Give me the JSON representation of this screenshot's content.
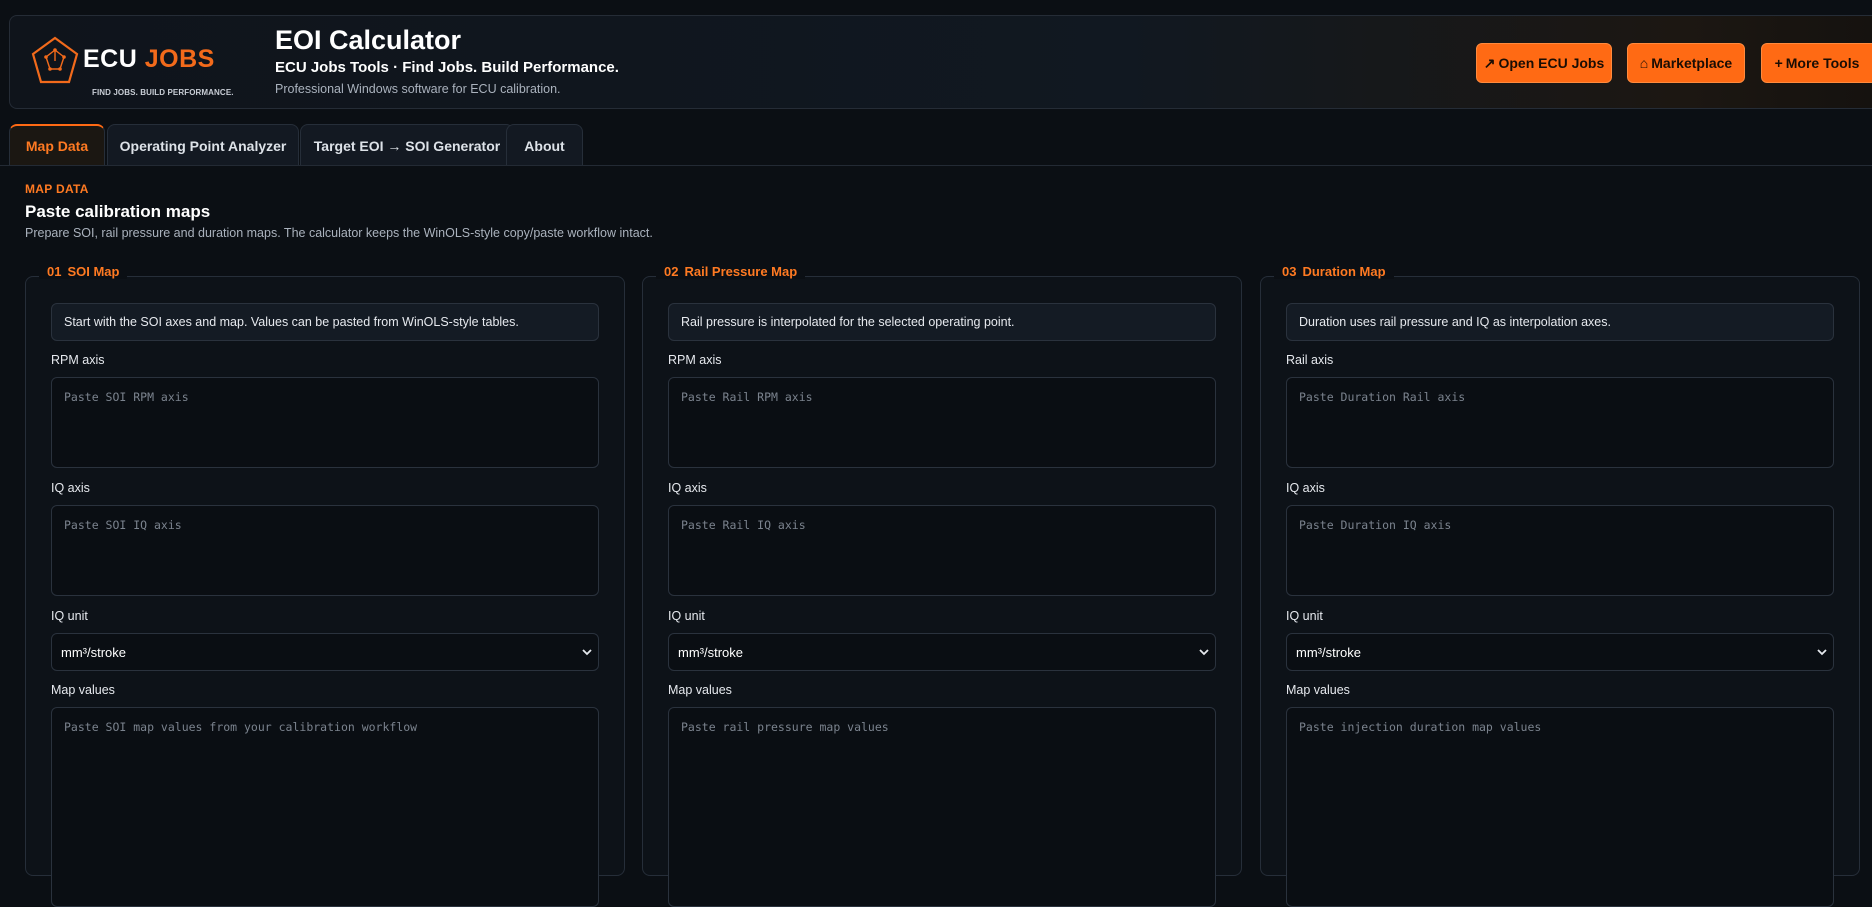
{
  "header": {
    "logo": {
      "word1": "ECU",
      "word2": "JOBS",
      "tagline": "FIND JOBS. BUILD PERFORMANCE."
    },
    "title": "EOI Calculator",
    "subtitle": "ECU Jobs Tools · Find Jobs. Build Performance.",
    "description": "Professional Windows software for ECU calibration.",
    "buttons": [
      {
        "icon": "↗",
        "label": "Open ECU Jobs"
      },
      {
        "icon": "⌂",
        "label": "Marketplace"
      },
      {
        "icon": "+",
        "label": "More Tools"
      }
    ]
  },
  "tabs": [
    {
      "label": "Map Data",
      "active": true
    },
    {
      "label": "Operating Point Analyzer",
      "active": false
    },
    {
      "label": "Target EOI → SOI Generator",
      "active": false
    },
    {
      "label": "About",
      "active": false
    }
  ],
  "section": {
    "kicker": "MAP DATA",
    "title": "Paste calibration maps",
    "description": "Prepare SOI, rail pressure and duration maps. The calculator keeps the WinOLS-style copy/paste workflow intact."
  },
  "cards": [
    {
      "number": "01",
      "title": "SOI Map",
      "info": "Start with the SOI axes and map. Values can be pasted from WinOLS-style tables.",
      "axis1_label": "RPM axis",
      "axis1_placeholder": "Paste SOI RPM axis",
      "axis2_label": "IQ axis",
      "axis2_placeholder": "Paste SOI IQ axis",
      "unit_label": "IQ unit",
      "unit_value": "mm³/stroke",
      "values_label": "Map values",
      "values_placeholder": "Paste SOI map values from your calibration workflow"
    },
    {
      "number": "02",
      "title": "Rail Pressure Map",
      "info": "Rail pressure is interpolated for the selected operating point.",
      "axis1_label": "RPM axis",
      "axis1_placeholder": "Paste Rail RPM axis",
      "axis2_label": "IQ axis",
      "axis2_placeholder": "Paste Rail IQ axis",
      "unit_label": "IQ unit",
      "unit_value": "mm³/stroke",
      "values_label": "Map values",
      "values_placeholder": "Paste rail pressure map values"
    },
    {
      "number": "03",
      "title": "Duration Map",
      "info": "Duration uses rail pressure and IQ as interpolation axes.",
      "axis1_label": "Rail axis",
      "axis1_placeholder": "Paste Duration Rail axis",
      "axis2_label": "IQ axis",
      "axis2_placeholder": "Paste Duration IQ axis",
      "unit_label": "IQ unit",
      "unit_value": "mm³/stroke",
      "values_label": "Map values",
      "values_placeholder": "Paste injection duration map values"
    }
  ]
}
